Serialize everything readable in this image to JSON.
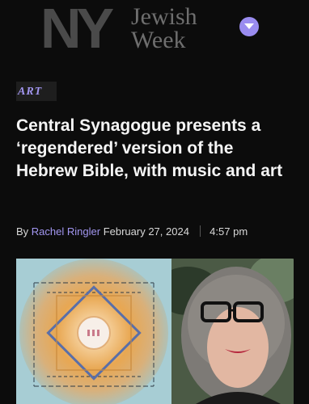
{
  "header": {
    "logo_letters": "NY",
    "logo_word_1": "Jewish",
    "logo_word_2": "Week",
    "menu_icon": "chevron-down-icon",
    "colors": {
      "accent": "#9a8cf0",
      "background": "#0c0c0c"
    }
  },
  "article": {
    "category": "ART",
    "headline": "Central Synagogue presents a ‘regendered’ version of the Hebrew Bible, with music and art",
    "byline": {
      "prefix": "By",
      "author": "Rachel Ringler",
      "date": "February 27, 2024",
      "time": "4:57 pm"
    },
    "hero_image": {
      "left_panel": "illustrated artwork with Hebrew lettering",
      "right_panel": "portrait of woman with gray curly hair and black glasses"
    }
  }
}
